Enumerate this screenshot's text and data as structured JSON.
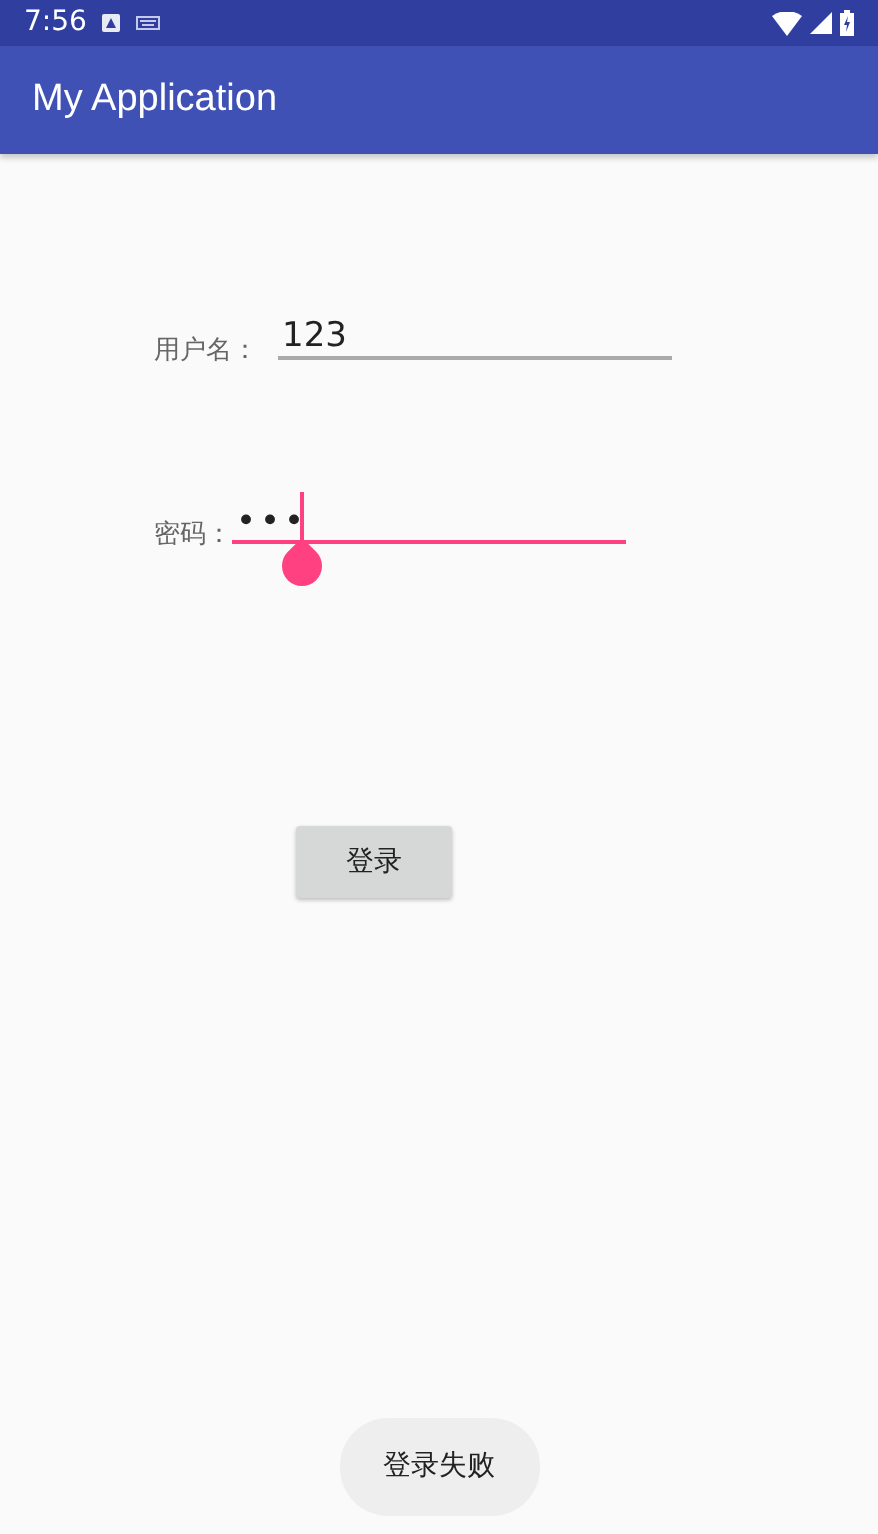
{
  "status_bar": {
    "time": "7:56"
  },
  "app_bar": {
    "title": "My Application"
  },
  "fields": [
    {
      "label": "用户名：",
      "value": "123",
      "focused": false
    },
    {
      "label": "密码：",
      "value": "•••",
      "focused": true
    }
  ],
  "login_button": {
    "label": "登录"
  },
  "toast": {
    "text": "登录失败"
  }
}
